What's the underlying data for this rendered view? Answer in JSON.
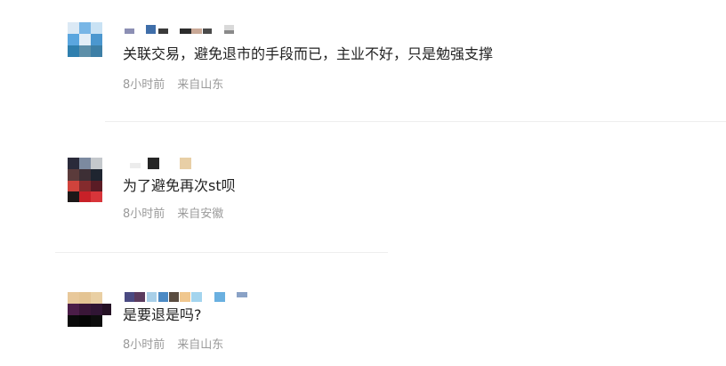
{
  "comments": [
    {
      "content": "关联交易，避免退市的手段而已，主业不好，只是勉强支撑",
      "time": "8小时前",
      "location": "来自山东"
    },
    {
      "content": "为了避免再次st呗",
      "time": "8小时前",
      "location": "来自安徽"
    },
    {
      "content": "是要退是吗?",
      "time": "8小时前",
      "location": "来自山东"
    }
  ]
}
